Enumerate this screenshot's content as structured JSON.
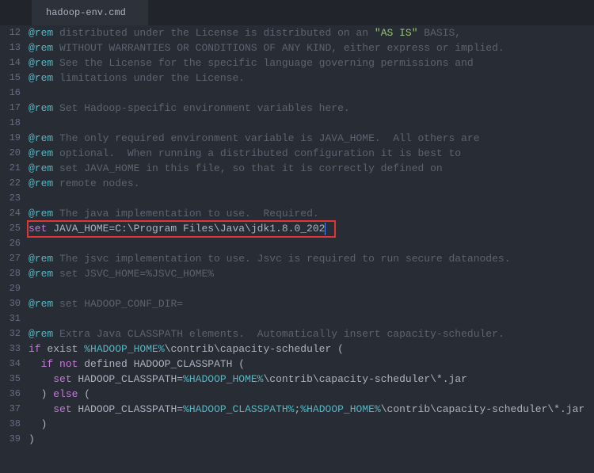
{
  "tab": {
    "title": "hadoop-env.cmd"
  },
  "gutter": {
    "start": 12,
    "end": 39
  },
  "lines": {
    "l12": {
      "rem": "@rem",
      "t1": " distributed under the License is distributed on an ",
      "str": "\"AS IS\"",
      "t2": " BASIS,"
    },
    "l13": {
      "rem": "@rem",
      "t": " WITHOUT WARRANTIES OR CONDITIONS OF ANY KIND, either express or implied."
    },
    "l14": {
      "rem": "@rem",
      "t": " See the License for the specific language governing permissions and"
    },
    "l15": {
      "rem": "@rem",
      "t": " limitations under the License."
    },
    "l17": {
      "rem": "@rem",
      "t": " Set Hadoop-specific environment variables here."
    },
    "l19": {
      "rem": "@rem",
      "t": " The only required environment variable is JAVA_HOME.  All others are"
    },
    "l20": {
      "rem": "@rem",
      "t": " optional.  When running a distributed configuration it is best to"
    },
    "l21": {
      "rem": "@rem",
      "t": " set JAVA_HOME in this file, so that it is correctly defined on"
    },
    "l22": {
      "rem": "@rem",
      "t": " remote nodes."
    },
    "l24": {
      "rem": "@rem",
      "t": " The java implementation to use.  Required."
    },
    "l25": {
      "set": "set",
      "t": " JAVA_HOME=C:\\Program Files\\Java\\jdk1.8.0_202"
    },
    "l27": {
      "rem": "@rem",
      "t": " The jsvc implementation to use. Jsvc is required to run secure datanodes."
    },
    "l28": {
      "rem": "@rem",
      "t1": " set JSVC_HOME=",
      "var": "%JSVC_HOME%"
    },
    "l30": {
      "rem": "@rem",
      "t": " set HADOOP_CONF_DIR="
    },
    "l32": {
      "rem": "@rem",
      "t": " Extra Java CLASSPATH elements.  Automatically insert capacity-scheduler."
    },
    "l33": {
      "kw": "if",
      "t1": " exist ",
      "var": "%HADOOP_HOME%",
      "t2": "\\contrib\\capacity-scheduler ("
    },
    "l34": {
      "indent": "  ",
      "kw1": "if",
      "kw2": " not",
      "t": " defined HADOOP_CLASSPATH ("
    },
    "l35": {
      "indent": "    ",
      "set": "set",
      "t1": " HADOOP_CLASSPATH=",
      "var": "%HADOOP_HOME%",
      "t2": "\\contrib\\capacity-scheduler\\*.jar"
    },
    "l36": {
      "indent": "  ",
      "t1": ") ",
      "kw": "else",
      "t2": " ("
    },
    "l37": {
      "indent": "    ",
      "set": "set",
      "t1": " HADOOP_CLASSPATH=",
      "var1": "%HADOOP_CLASSPATH%",
      "t2": ";",
      "var2": "%HADOOP_HOME%",
      "t3": "\\contrib\\capacity-scheduler\\*.jar"
    },
    "l38": {
      "indent": "  ",
      "t": ")"
    },
    "l39": {
      "t": ")"
    }
  }
}
